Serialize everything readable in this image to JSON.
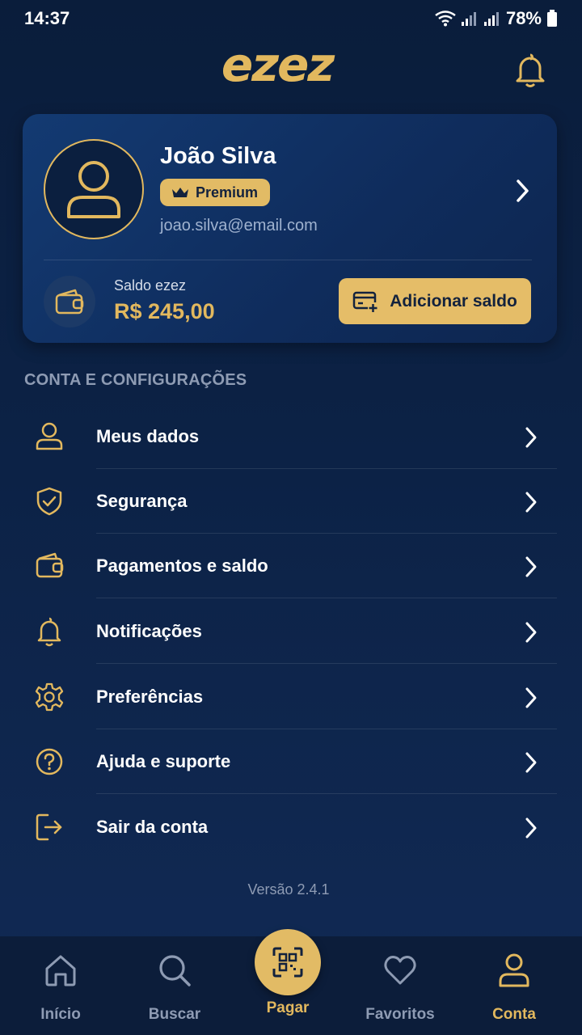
{
  "status_bar": {
    "time": "14:37",
    "battery": "78%"
  },
  "header": {
    "logo_text": "ezez"
  },
  "profile": {
    "name": "João Silva",
    "badge": "Premium",
    "email": "joao.silva@email.com",
    "balance_label": "Saldo ezez",
    "balance_value": "R$ 245,00",
    "add_balance_label": "Adicionar saldo"
  },
  "settings": {
    "section_title": "CONTA E CONFIGURAÇÕES",
    "items": [
      {
        "label": "Meus dados",
        "icon": "user-icon"
      },
      {
        "label": "Segurança",
        "icon": "shield-check-icon"
      },
      {
        "label": "Pagamentos e saldo",
        "icon": "wallet-icon"
      },
      {
        "label": "Notificações",
        "icon": "bell-icon"
      },
      {
        "label": "Preferências",
        "icon": "gear-icon"
      },
      {
        "label": "Ajuda e suporte",
        "icon": "help-circle-icon"
      },
      {
        "label": "Sair da conta",
        "icon": "logout-icon"
      }
    ]
  },
  "version": "Versão 2.4.1",
  "bottom_nav": {
    "items": [
      {
        "label": "Início",
        "icon": "home-icon"
      },
      {
        "label": "Buscar",
        "icon": "search-icon"
      },
      {
        "label": "Pagar",
        "icon": "qr-scan-icon"
      },
      {
        "label": "Favoritos",
        "icon": "heart-icon"
      },
      {
        "label": "Conta",
        "icon": "user-icon"
      }
    ],
    "active": "Conta"
  },
  "colors": {
    "accent": "#e2b85e",
    "background": "#0c2246",
    "muted": "#8e9bb3"
  }
}
